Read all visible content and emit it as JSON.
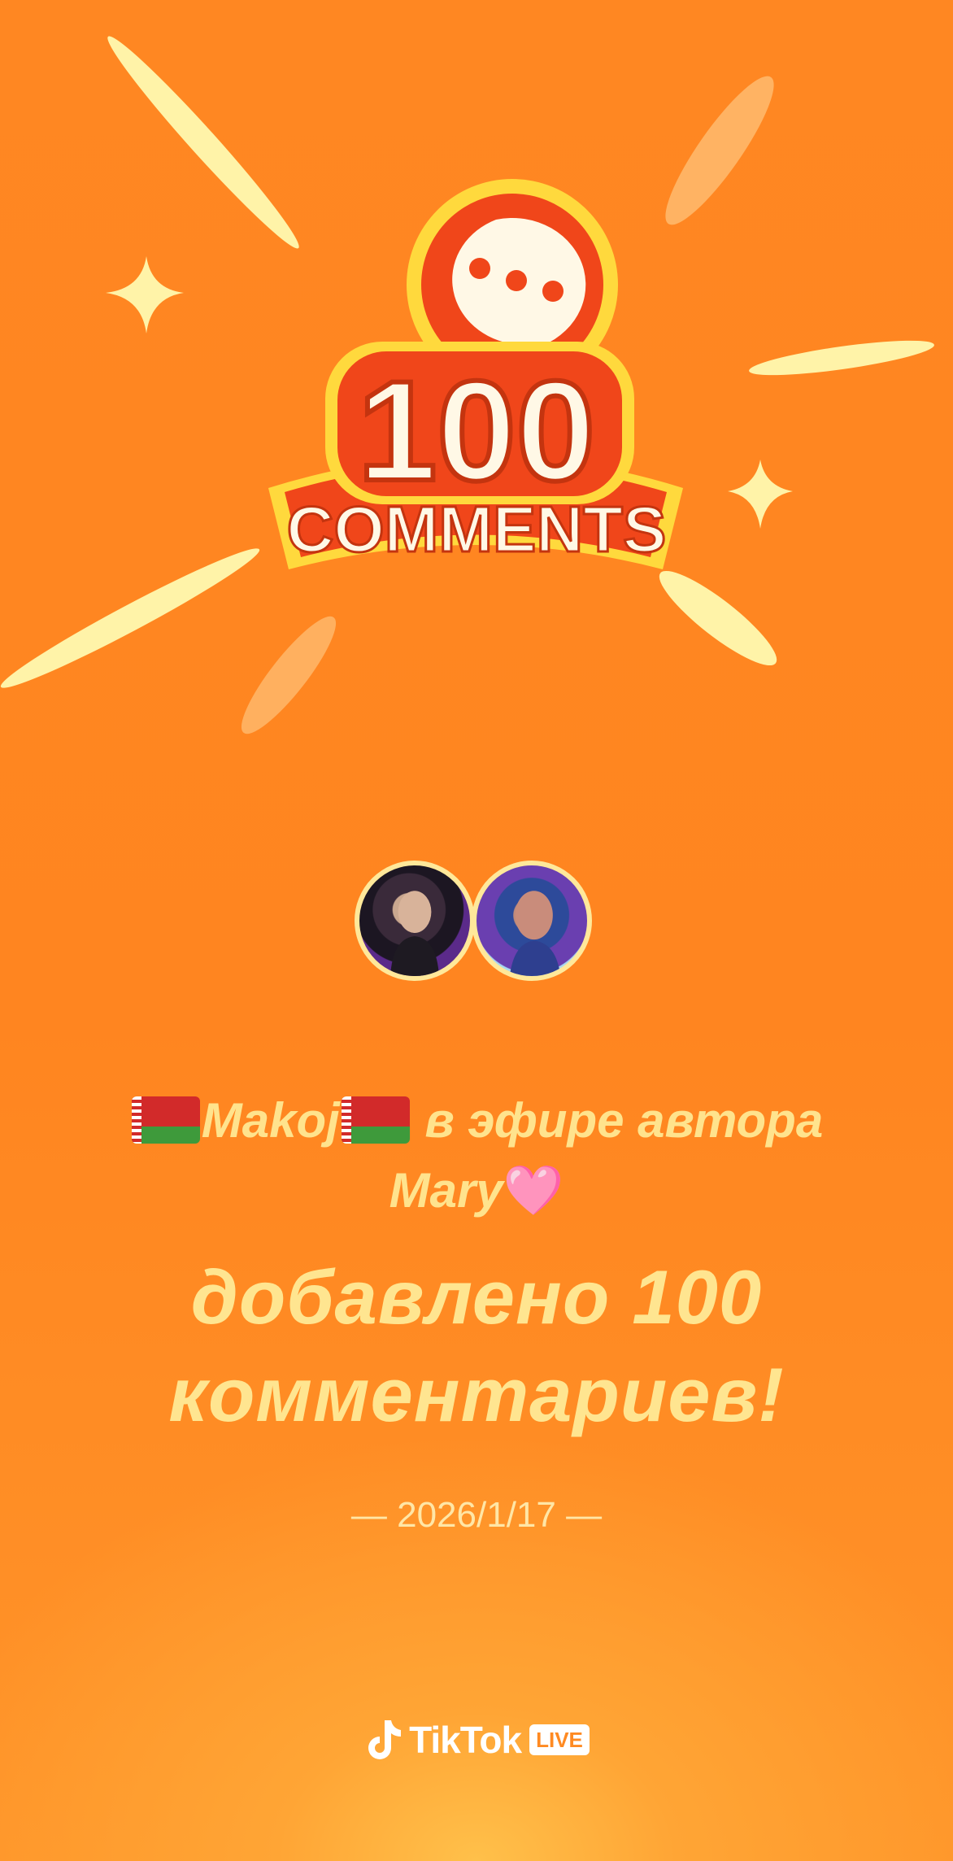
{
  "badge": {
    "number": "100",
    "word": "COMMENTS"
  },
  "avatars": [
    {
      "name": "viewer-avatar"
    },
    {
      "name": "host-avatar"
    }
  ],
  "headline": {
    "viewer_name": "Makoj",
    "text_middle": "в эфире автора",
    "host_name": "Mary",
    "heart": "🩷"
  },
  "milestone": {
    "line1": "добавлено 100",
    "line2": "комментариев!"
  },
  "date": "— 2026/1/17 —",
  "footer": {
    "brand": "TikTok",
    "tag": "LIVE"
  },
  "colors": {
    "background": "#ff8722",
    "headline_text": "#ffe38d",
    "badge_red": "#f0461a",
    "badge_outline": "#ffd93d"
  }
}
